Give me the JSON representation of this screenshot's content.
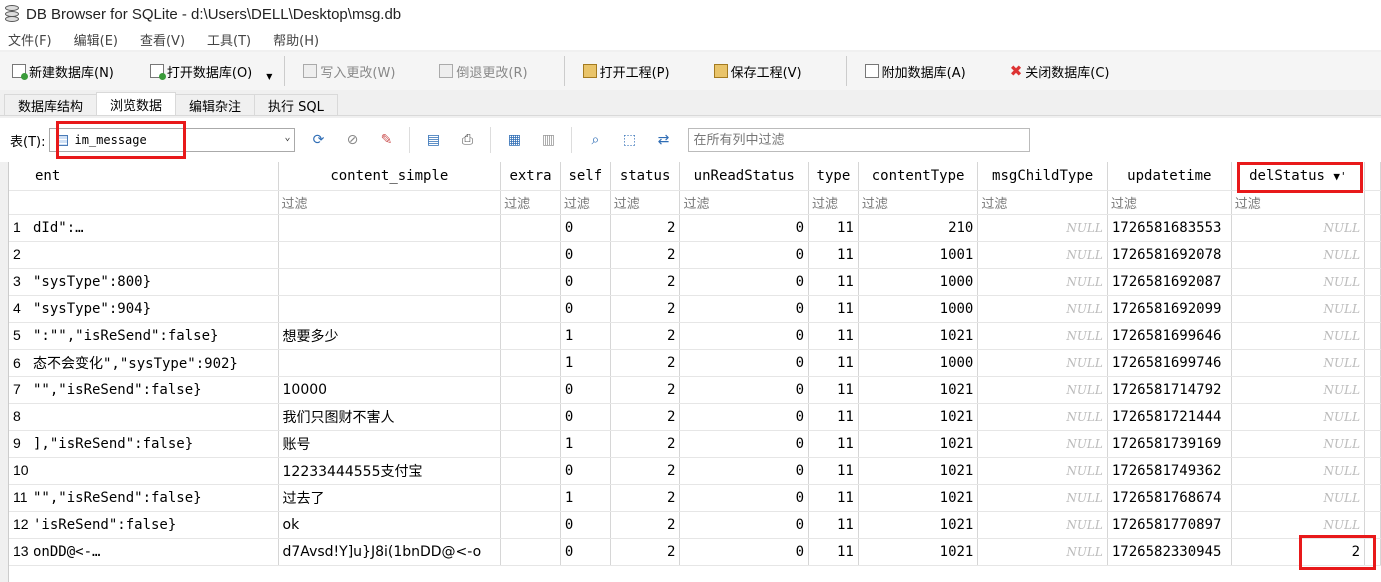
{
  "window": {
    "title": "DB Browser for SQLite - d:\\Users\\DELL\\Desktop\\msg.db"
  },
  "menu": [
    "文件(F)",
    "编辑(E)",
    "查看(V)",
    "工具(T)",
    "帮助(H)"
  ],
  "toolbar": {
    "new_db": "新建数据库(N)",
    "open_db": "打开数据库(O)",
    "write_changes": "写入更改(W)",
    "revert_changes": "倒退更改(R)",
    "open_project": "打开工程(P)",
    "save_project": "保存工程(V)",
    "attach_db": "附加数据库(A)",
    "close_db": "关闭数据库(C)"
  },
  "tabs": [
    "数据库结构",
    "浏览数据",
    "编辑杂注",
    "执行 SQL"
  ],
  "browse": {
    "table_label": "表(T):",
    "table_value": "im_message",
    "filter_placeholder": "在所有列中过滤",
    "filter_cell": "过滤"
  },
  "columns": [
    "ent",
    "content_simple",
    "extra",
    "self",
    "status",
    "unReadStatus",
    "type",
    "contentType",
    "msgChildType",
    "updatetime",
    "delStatus"
  ],
  "delStatus_sort_marker": "▼'",
  "rows": [
    {
      "rownum": "1",
      "ent": "dId\":…",
      "content_simple": "",
      "extra": "",
      "self": "0",
      "status": "2",
      "unReadStatus": "0",
      "type": "11",
      "contentType": "210",
      "msgChildType": "NULL",
      "updatetime": "1726581683553",
      "delStatus": "NULL"
    },
    {
      "rownum": "2",
      "ent": "",
      "content_simple": "",
      "extra": "",
      "self": "0",
      "status": "2",
      "unReadStatus": "0",
      "type": "11",
      "contentType": "1001",
      "msgChildType": "NULL",
      "updatetime": "1726581692078",
      "delStatus": "NULL"
    },
    {
      "rownum": "3",
      "ent": "\"sysType\":800}",
      "content_simple": "",
      "extra": "",
      "self": "0",
      "status": "2",
      "unReadStatus": "0",
      "type": "11",
      "contentType": "1000",
      "msgChildType": "NULL",
      "updatetime": "1726581692087",
      "delStatus": "NULL"
    },
    {
      "rownum": "4",
      "ent": "\"sysType\":904}",
      "content_simple": "",
      "extra": "",
      "self": "0",
      "status": "2",
      "unReadStatus": "0",
      "type": "11",
      "contentType": "1000",
      "msgChildType": "NULL",
      "updatetime": "1726581692099",
      "delStatus": "NULL"
    },
    {
      "rownum": "5",
      "ent": "\":\"\",\"isReSend\":false}",
      "content_simple": "想要多少",
      "extra": "",
      "self": "1",
      "status": "2",
      "unReadStatus": "0",
      "type": "11",
      "contentType": "1021",
      "msgChildType": "NULL",
      "updatetime": "1726581699646",
      "delStatus": "NULL"
    },
    {
      "rownum": "6",
      "ent": "态不会变化\",\"sysType\":902}",
      "content_simple": "",
      "extra": "",
      "self": "1",
      "status": "2",
      "unReadStatus": "0",
      "type": "11",
      "contentType": "1000",
      "msgChildType": "NULL",
      "updatetime": "1726581699746",
      "delStatus": "NULL"
    },
    {
      "rownum": "7",
      "ent": "\"\",\"isReSend\":false}",
      "content_simple": "10000",
      "extra": "",
      "self": "0",
      "status": "2",
      "unReadStatus": "0",
      "type": "11",
      "contentType": "1021",
      "msgChildType": "NULL",
      "updatetime": "1726581714792",
      "delStatus": "NULL"
    },
    {
      "rownum": "8",
      "ent": "",
      "content_simple": "我们只图财不害人",
      "extra": "",
      "self": "0",
      "status": "2",
      "unReadStatus": "0",
      "type": "11",
      "contentType": "1021",
      "msgChildType": "NULL",
      "updatetime": "1726581721444",
      "delStatus": "NULL"
    },
    {
      "rownum": "9",
      "ent": "],\"isReSend\":false}",
      "content_simple": "账号",
      "extra": "",
      "self": "1",
      "status": "2",
      "unReadStatus": "0",
      "type": "11",
      "contentType": "1021",
      "msgChildType": "NULL",
      "updatetime": "1726581739169",
      "delStatus": "NULL"
    },
    {
      "rownum": "10",
      "ent": "",
      "content_simple": "12233444555支付宝",
      "extra": "",
      "self": "0",
      "status": "2",
      "unReadStatus": "0",
      "type": "11",
      "contentType": "1021",
      "msgChildType": "NULL",
      "updatetime": "1726581749362",
      "delStatus": "NULL"
    },
    {
      "rownum": "11",
      "ent": "\"\",\"isReSend\":false}",
      "content_simple": "过去了",
      "extra": "",
      "self": "1",
      "status": "2",
      "unReadStatus": "0",
      "type": "11",
      "contentType": "1021",
      "msgChildType": "NULL",
      "updatetime": "1726581768674",
      "delStatus": "NULL"
    },
    {
      "rownum": "12",
      "ent": "'isReSend\":false}",
      "content_simple": "ok",
      "extra": "",
      "self": "0",
      "status": "2",
      "unReadStatus": "0",
      "type": "11",
      "contentType": "1021",
      "msgChildType": "NULL",
      "updatetime": "1726581770897",
      "delStatus": "NULL"
    },
    {
      "rownum": "13",
      "ent": "onDD@<-…",
      "content_simple": "d7Avsd!Y]u}J8i(1bnDD@<-o",
      "extra": "",
      "self": "0",
      "status": "2",
      "unReadStatus": "0",
      "type": "11",
      "contentType": "1021",
      "msgChildType": "NULL",
      "updatetime": "1726582330945",
      "delStatus": "2"
    }
  ],
  "colors": {
    "highlight": "#e8191a",
    "null_text": "#bbbbbb"
  },
  "icons": [
    "database-icon",
    "refresh-icon",
    "clear-filter-icon",
    "save-filter-icon",
    "export-icon",
    "print-icon",
    "insert-record-icon",
    "delete-record-icon",
    "find-icon",
    "goto-icon",
    "replace-icon"
  ]
}
